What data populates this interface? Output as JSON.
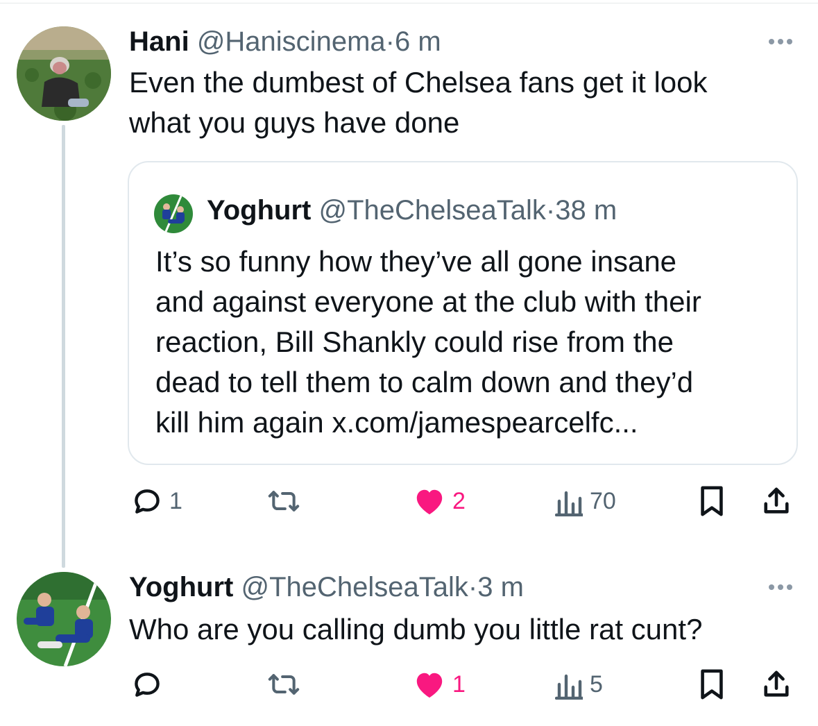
{
  "thread": [
    {
      "display_name": "Hani",
      "handle": "@Haniscinema",
      "separator": "·",
      "time": "6 m",
      "text_lines": [
        "Even the dumbest of Chelsea fans get it look",
        "what you guys have done"
      ],
      "avatar": "hani-avatar",
      "quote": {
        "display_name": "Yoghurt",
        "handle": "@TheChelseaTalk",
        "separator": "·",
        "time": "38 m",
        "text_lines": [
          "It’s so funny how they’ve all gone insane",
          "and against everyone at the club with their",
          "reaction, Bill Shankly could rise from the",
          "dead to tell them to calm down and they’d",
          "kill him again x.com/jamespearcelfc..."
        ],
        "avatar": "yoghurt-avatar"
      },
      "stats": {
        "replies": "1",
        "retweets": "",
        "likes": "2",
        "views": "70"
      },
      "liked": true
    },
    {
      "display_name": "Yoghurt",
      "handle": "@TheChelseaTalk",
      "separator": "·",
      "time": "3 m",
      "text_lines": [
        "Who are you calling dumb you little rat cunt?"
      ],
      "avatar": "yoghurt-avatar",
      "stats": {
        "replies": "",
        "retweets": "",
        "likes": "1",
        "views": "5"
      },
      "liked": true
    }
  ],
  "colors": {
    "text": "#0f1419",
    "secondary": "#536471",
    "like": "#f91880",
    "border": "#e1e8ed",
    "thread_line": "#cfd9de"
  },
  "icons": {
    "reply": "reply-icon",
    "retweet": "retweet-icon",
    "like": "heart-icon",
    "views": "views-icon",
    "bookmark": "bookmark-icon",
    "share": "share-icon",
    "more": "more-icon"
  }
}
